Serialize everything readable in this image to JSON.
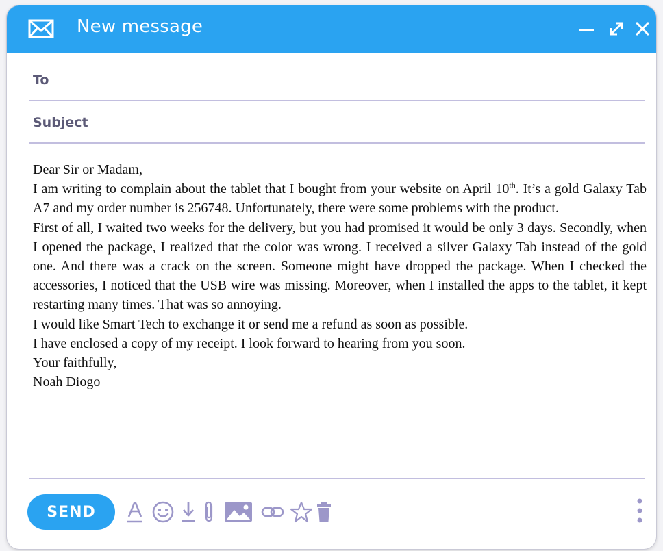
{
  "window": {
    "title": "New message"
  },
  "fields": {
    "to_label": "To",
    "to_value": "",
    "subject_label": "Subject",
    "subject_value": ""
  },
  "body": {
    "greeting": "Dear Sir or Madam,",
    "p1_before_sup": "I am writing to complain about the tablet that I bought from your website on April 10",
    "p1_sup": "th",
    "p1_after_sup": ". It’s a gold Galaxy Tab A7 and my order number is 256748. Unfortunately, there were some problems with the product.",
    "p2": "First of all, I waited two weeks for the delivery, but you had promised it would be only 3 days. Secondly, when I opened the package, I realized that the color was wrong. I received a silver Galaxy Tab instead of the gold one. And there was a crack on the screen. Someone might have dropped the package. When I checked the accessories, I noticed that the USB wire was missing. Moreover, when I installed the apps to the tablet, it kept restarting many times. That was so annoying.",
    "p3": "I would like Smart Tech to exchange it or send me a refund as soon as possible.",
    "p4": "I have enclosed a copy of my receipt. I look forward to hearing from you soon.",
    "closing": "Your faithfully,",
    "signature": "Noah Diogo"
  },
  "toolbar": {
    "send_label": "SEND",
    "icons": [
      "text-format-icon",
      "emoji-icon",
      "download-icon",
      "attachment-icon",
      "image-icon",
      "link-icon",
      "star-icon",
      "trash-icon",
      "more-options-icon"
    ]
  },
  "colors": {
    "accent": "#2aa3f1",
    "icon": "#9c97c9",
    "divider": "#c2bedf",
    "label": "#5c5a77"
  }
}
